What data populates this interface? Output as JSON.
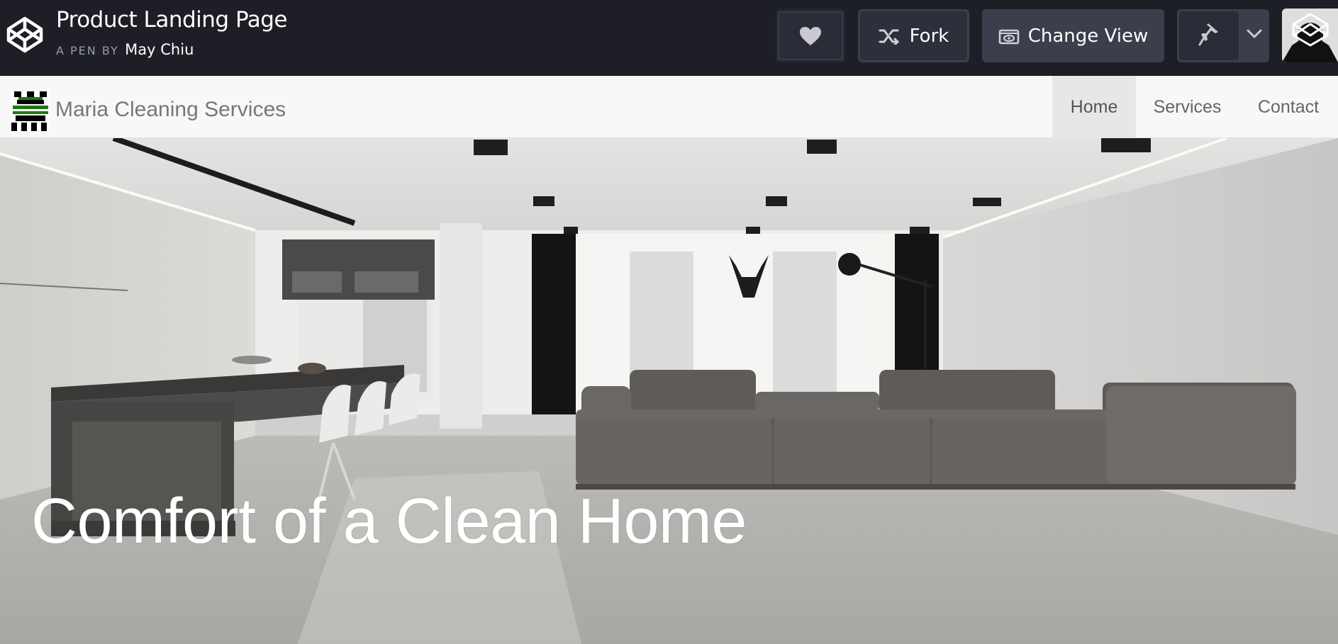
{
  "codepen": {
    "title": "Product Landing Page",
    "byline_label": "A PEN BY",
    "author": "May Chiu",
    "buttons": {
      "like_icon": "heart-icon",
      "fork_label": "Fork",
      "change_view_label": "Change View",
      "pin_icon": "pin-icon",
      "menu_icon": "chevron-down-icon"
    }
  },
  "site": {
    "name": "Maria Cleaning Services",
    "nav": [
      {
        "label": "Home",
        "active": true
      },
      {
        "label": "Services",
        "active": false
      },
      {
        "label": "Contact",
        "active": false
      }
    ],
    "hero_title": "Comfort of a Clean Home"
  },
  "colors": {
    "codepen_bar": "#1e1f26",
    "nav_bg": "#f8f8f8",
    "nav_active_bg": "#e7e7e7",
    "logo_green": "#1a7a12"
  }
}
